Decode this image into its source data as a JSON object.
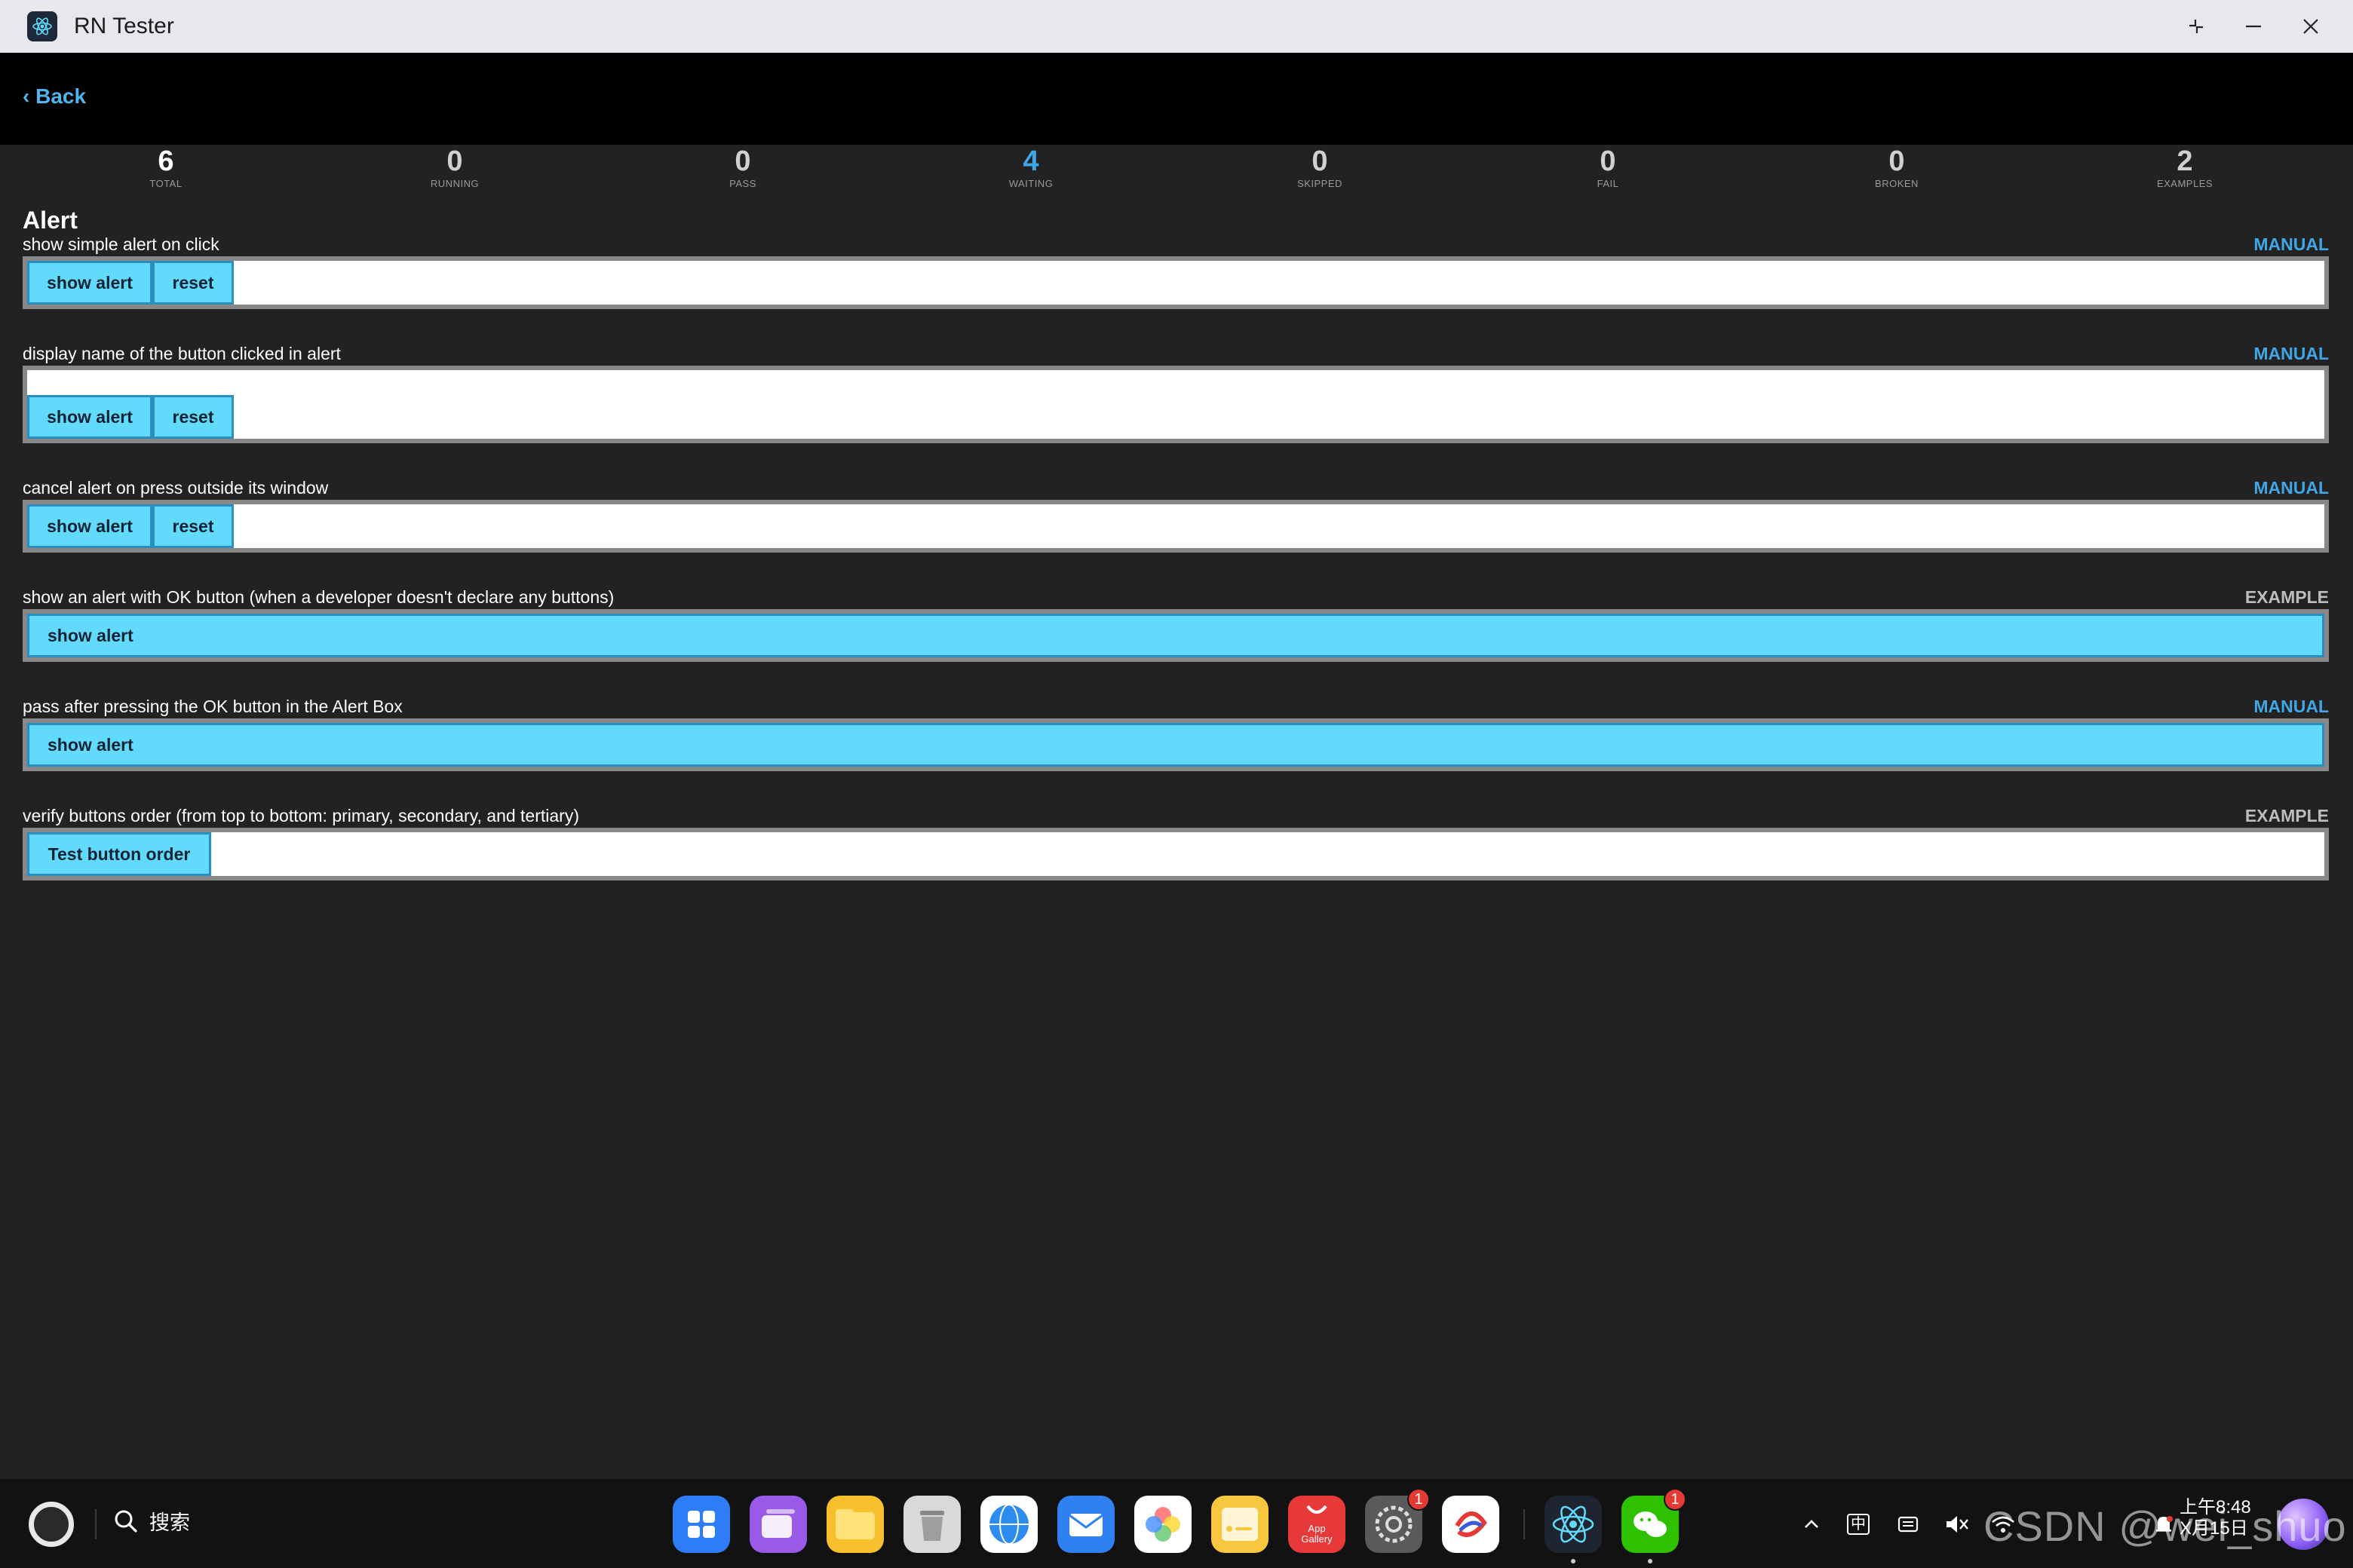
{
  "window": {
    "title": "RN Tester"
  },
  "header": {
    "back_label": "‹ Back"
  },
  "stats": [
    {
      "value": "6",
      "label": "TOTAL"
    },
    {
      "value": "0",
      "label": "RUNNING"
    },
    {
      "value": "0",
      "label": "PASS"
    },
    {
      "value": "4",
      "label": "WAITING"
    },
    {
      "value": "0",
      "label": "SKIPPED"
    },
    {
      "value": "0",
      "label": "FAIL"
    },
    {
      "value": "0",
      "label": "BROKEN"
    },
    {
      "value": "2",
      "label": "EXAMPLES"
    }
  ],
  "section": {
    "title": "Alert"
  },
  "cases": [
    {
      "label": "show simple alert on click",
      "status": "MANUAL",
      "buttons": [
        "show alert",
        "reset"
      ]
    },
    {
      "label": "display name of the button clicked in alert",
      "status": "MANUAL",
      "buttons": [
        "show alert",
        "reset"
      ]
    },
    {
      "label": "cancel alert on press outside its window",
      "status": "MANUAL",
      "buttons": [
        "show alert",
        "reset"
      ]
    },
    {
      "label": "show an alert with OK button (when a developer doesn't declare any buttons)",
      "status": "EXAMPLE",
      "buttons": [
        "show alert"
      ]
    },
    {
      "label": "pass after pressing the OK button in the Alert Box",
      "status": "MANUAL",
      "buttons": [
        "show alert"
      ]
    },
    {
      "label": "verify buttons order (from top to bottom: primary, secondary, and tertiary)",
      "status": "EXAMPLE",
      "buttons": [
        "Test button order"
      ]
    }
  ],
  "taskbar": {
    "search_label": "搜索",
    "dock": [
      {
        "icon": "app-launcher-icon",
        "color": "#2f7df6"
      },
      {
        "icon": "multitask-icon",
        "color": "#9b59e8"
      },
      {
        "icon": "files-icon",
        "color": "#f5c02c"
      },
      {
        "icon": "trash-icon",
        "color": "#cfcfcf"
      },
      {
        "icon": "browser-icon",
        "color": "#2d8cf0"
      },
      {
        "icon": "mail-icon",
        "color": "#2f80f0"
      },
      {
        "icon": "gallery-icon",
        "color": "#ffffff"
      },
      {
        "icon": "notes-icon",
        "color": "#f7c740"
      },
      {
        "icon": "app-gallery-icon",
        "color": "#e8393a",
        "label": "App\nGallery"
      },
      {
        "icon": "settings-icon",
        "color": "#5a5a5a",
        "badge": "1"
      },
      {
        "icon": "huawei-app-icon",
        "color": "#ffffff"
      },
      {
        "icon": "react-icon",
        "color": "#1f2530"
      },
      {
        "icon": "wechat-icon",
        "color": "#2dc100",
        "badge": "1"
      }
    ],
    "tray": {
      "ime_label": "中",
      "clock_time": "上午8:48",
      "clock_date": "X月15日"
    },
    "watermark": "CSDN @wei_shuo"
  }
}
